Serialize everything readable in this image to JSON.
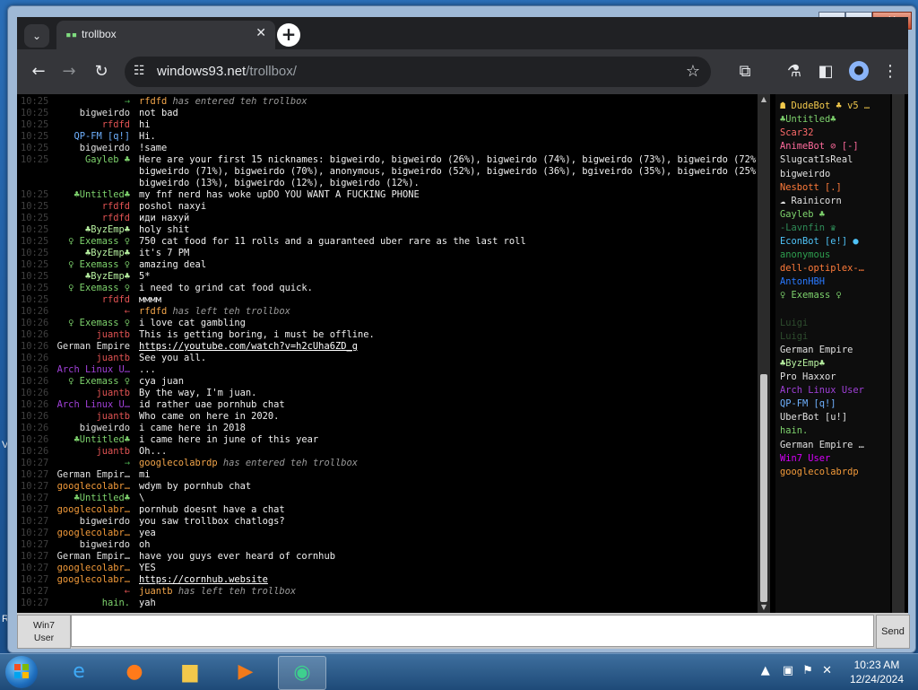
{
  "browser": {
    "tab_title": "trollbox",
    "tab_favicon_text": "▪▪",
    "url_domain": "windows93.net",
    "url_path": "/trollbox/"
  },
  "icons": {
    "tab_menu": "chevron-down-icon",
    "close": "close-icon",
    "newtab": "plus-icon",
    "back": "arrow-left-icon",
    "forward": "arrow-right-icon",
    "reload": "reload-icon",
    "site_info": "tune-icon",
    "bookmark": "star-icon",
    "extensions": "puzzle-icon",
    "labs": "flask-icon",
    "sidepanel": "sidepanel-icon",
    "profile": "profile-icon",
    "menu": "kebab-menu-icon"
  },
  "colors": {
    "timestamp": "#3f3f3f",
    "message": "#f0f0f0",
    "system": "#f2a54a"
  },
  "messages": [
    {
      "time": "10:25",
      "nick": "→",
      "nick_color": "#4caf50",
      "text": "rfdfd",
      "sys": "has entered teh trollbox",
      "type": "system"
    },
    {
      "time": "10:25",
      "nick": "bigweirdo",
      "nick_color": "#e0e0e0",
      "text": "not bad",
      "type": "chat"
    },
    {
      "time": "10:25",
      "nick": "rfdfd",
      "nick_color": "#e25353",
      "text": "hi",
      "type": "chat"
    },
    {
      "time": "10:25",
      "nick": "QP-FM [q!]",
      "nick_color": "#6fb1ff",
      "text": "Hi.",
      "type": "chat"
    },
    {
      "time": "10:25",
      "nick": "bigweirdo",
      "nick_color": "#e0e0e0",
      "text": "!same",
      "type": "chat"
    },
    {
      "time": "10:25",
      "nick": "Gayleb ♣",
      "nick_color": "#7ed36d",
      "text": "Here are your first 15 nicknames: bigweirdo, bigweirdo (26%), bigweirdo (74%), bigweirdo (73%), bigweirdo (72%),",
      "type": "chat"
    },
    {
      "time": "",
      "nick": "",
      "nick_color": "#7ed36d",
      "text": "bigweirdo (71%), bigweirdo (70%), anonymous, bigweirdo (52%), bigweirdo (36%), bgiveirdo (35%), bigweirdo (25%),",
      "type": "chat"
    },
    {
      "time": "",
      "nick": "",
      "nick_color": "#7ed36d",
      "text": "bigweirdo (13%), bigweirdo (12%), bigweirdo (12%).",
      "type": "chat"
    },
    {
      "time": "10:25",
      "nick": "♣Untitled♣",
      "nick_color": "#7ed36d",
      "text": "my fnf nerd has woke upDO YOU WANT A FUCKING PHONE",
      "type": "chat"
    },
    {
      "time": "10:25",
      "nick": "rfdfd",
      "nick_color": "#e25353",
      "text": "poshol naxyi",
      "type": "chat"
    },
    {
      "time": "10:25",
      "nick": "rfdfd",
      "nick_color": "#e25353",
      "text": "иди нахуй",
      "type": "chat"
    },
    {
      "time": "10:25",
      "nick": "♣ByzEmp♣",
      "nick_color": "#b7f0a0",
      "text": "holy shit",
      "type": "chat"
    },
    {
      "time": "10:25",
      "nick": "♀ Exemass ♀",
      "nick_color": "#7ed36d",
      "text": "750 cat food for 11 rolls and a guaranteed uber rare as the last roll",
      "type": "chat"
    },
    {
      "time": "10:25",
      "nick": "♣ByzEmp♣",
      "nick_color": "#b7f0a0",
      "text": "it's 7 PM",
      "type": "chat"
    },
    {
      "time": "10:25",
      "nick": "♀ Exemass ♀",
      "nick_color": "#7ed36d",
      "text": "amazing deal",
      "type": "chat"
    },
    {
      "time": "10:25",
      "nick": "♣ByzEmp♣",
      "nick_color": "#b7f0a0",
      "text": "5*",
      "type": "chat"
    },
    {
      "time": "10:25",
      "nick": "♀ Exemass ♀",
      "nick_color": "#7ed36d",
      "text": "i need to grind cat food quick.",
      "type": "chat"
    },
    {
      "time": "10:25",
      "nick": "rfdfd",
      "nick_color": "#e25353",
      "text": "мммм",
      "type": "chat"
    },
    {
      "time": "10:26",
      "nick": "←",
      "nick_color": "#e25353",
      "text": "rfdfd",
      "sys": "has left teh trollbox",
      "type": "system"
    },
    {
      "time": "10:26",
      "nick": "♀ Exemass ♀",
      "nick_color": "#7ed36d",
      "text": "i love cat gambling",
      "type": "chat"
    },
    {
      "time": "10:26",
      "nick": "juantb",
      "nick_color": "#e25353",
      "text": "This is getting boring, i must be offline.",
      "type": "chat"
    },
    {
      "time": "10:26",
      "nick": "German Empire",
      "nick_color": "#e0e0e0",
      "text": "https://youtube.com/watch?v=h2cUha6ZD_g",
      "type": "link"
    },
    {
      "time": "10:26",
      "nick": "juantb",
      "nick_color": "#e25353",
      "text": "See you all.",
      "type": "chat"
    },
    {
      "time": "10:26",
      "nick": "Arch Linux U…",
      "nick_color": "#a040d8",
      "text": "...",
      "type": "chat"
    },
    {
      "time": "10:26",
      "nick": "♀ Exemass ♀",
      "nick_color": "#7ed36d",
      "text": "cya juan",
      "type": "chat"
    },
    {
      "time": "10:26",
      "nick": "juantb",
      "nick_color": "#e25353",
      "text": "By the way, I'm juan.",
      "type": "chat"
    },
    {
      "time": "10:26",
      "nick": "Arch Linux U…",
      "nick_color": "#a040d8",
      "text": "id rather uae pornhub chat",
      "type": "chat"
    },
    {
      "time": "10:26",
      "nick": "juantb",
      "nick_color": "#e25353",
      "text": "Who came on here in 2020.",
      "type": "chat"
    },
    {
      "time": "10:26",
      "nick": "bigweirdo",
      "nick_color": "#e0e0e0",
      "text": "i came here in 2018",
      "type": "chat"
    },
    {
      "time": "10:26",
      "nick": "♣Untitled♣",
      "nick_color": "#7ed36d",
      "text": "i came here in june of this year",
      "type": "chat"
    },
    {
      "time": "10:26",
      "nick": "juantb",
      "nick_color": "#e25353",
      "text": "Oh...",
      "type": "chat"
    },
    {
      "time": "10:27",
      "nick": "→",
      "nick_color": "#4caf50",
      "text": "googlecolabrdp",
      "sys": "has entered teh trollbox",
      "type": "system"
    },
    {
      "time": "10:27",
      "nick": "German Empir…",
      "nick_color": "#e0e0e0",
      "text": "mi",
      "type": "chat"
    },
    {
      "time": "10:27",
      "nick": "googlecolabr…",
      "nick_color": "#f29a3a",
      "text": "wdym by pornhub chat",
      "type": "chat"
    },
    {
      "time": "10:27",
      "nick": "♣Untitled♣",
      "nick_color": "#7ed36d",
      "text": "\\",
      "type": "chat"
    },
    {
      "time": "10:27",
      "nick": "googlecolabr…",
      "nick_color": "#f29a3a",
      "text": "pornhub doesnt have a chat",
      "type": "chat"
    },
    {
      "time": "10:27",
      "nick": "bigweirdo",
      "nick_color": "#e0e0e0",
      "text": "you saw trollbox chatlogs?",
      "type": "chat"
    },
    {
      "time": "10:27",
      "nick": "googlecolabr…",
      "nick_color": "#f29a3a",
      "text": "yea",
      "type": "chat"
    },
    {
      "time": "10:27",
      "nick": "bigweirdo",
      "nick_color": "#e0e0e0",
      "text": "oh",
      "type": "chat"
    },
    {
      "time": "10:27",
      "nick": "German Empir…",
      "nick_color": "#e0e0e0",
      "text": "have you guys ever heard of cornhub",
      "type": "chat"
    },
    {
      "time": "10:27",
      "nick": "googlecolabr…",
      "nick_color": "#f29a3a",
      "text": "YES",
      "type": "chat"
    },
    {
      "time": "10:27",
      "nick": "googlecolabr…",
      "nick_color": "#f29a3a",
      "text": "https://cornhub.website",
      "type": "link"
    },
    {
      "time": "10:27",
      "nick": "←",
      "nick_color": "#e25353",
      "text": "juantb",
      "sys": "has left teh trollbox",
      "type": "system"
    },
    {
      "time": "10:27",
      "nick": "hain.",
      "nick_color": "#7ed36d",
      "text": "yah",
      "type": "chat"
    }
  ],
  "users": [
    {
      "name": "☗ DudeBot ♣ v5 …",
      "color": "#f2c94c"
    },
    {
      "name": "♣Untitled♣",
      "color": "#7ed36d"
    },
    {
      "name": "Scar32",
      "color": "#ff6b6b"
    },
    {
      "name": "AnimeBot ⊘ [-]",
      "color": "#ff6b9d"
    },
    {
      "name": "SlugcatIsReal",
      "color": "#e0e0e0"
    },
    {
      "name": "bigweirdo",
      "color": "#e0e0e0"
    },
    {
      "name": "Nesbott [.]",
      "color": "#ff7b3a"
    },
    {
      "name": "☁ Rainicorn",
      "color": "#e0e0e0"
    },
    {
      "name": "Gayleb ♣",
      "color": "#7ed36d"
    },
    {
      "name": "-Lavnfin ♛",
      "color": "#2e8b57"
    },
    {
      "name": "EconBot [e!] ●",
      "color": "#4fc3f7"
    },
    {
      "name": "anonymous",
      "color": "#2e9e4f"
    },
    {
      "name": "dell-optiplex-…",
      "color": "#ff7b3a"
    },
    {
      "name": "AntonHBH",
      "color": "#2979ff"
    },
    {
      "name": "♀ Exemass ♀",
      "color": "#7ed36d"
    },
    {
      "name": "",
      ":color": "#4a148c",
      "color": "#4a148c"
    },
    {
      "name": "Luigi",
      "color": "#2e4d2e"
    },
    {
      "name": "Luigi",
      "color": "#2e4d2e"
    },
    {
      "name": "German Empire",
      "color": "#e0e0e0"
    },
    {
      "name": "♣ByzEmp♣",
      "color": "#b7f0a0"
    },
    {
      "name": "Pro Haxxor",
      "color": "#e0e0e0"
    },
    {
      "name": "Arch Linux User",
      "color": "#a040d8"
    },
    {
      "name": "QP-FM [q!]",
      "color": "#6fb1ff"
    },
    {
      "name": "UberBot [u!]",
      "color": "#e0e0e0"
    },
    {
      "name": "hain.",
      "color": "#7ed36d"
    },
    {
      "name": "German Empire …",
      "color": "#e0e0e0"
    },
    {
      "name": "Win7 User",
      "color": "#d500f9"
    },
    {
      "name": "googlecolabrdp",
      "color": "#f29a3a"
    }
  ],
  "input": {
    "user_line1": "Win7",
    "user_line2": "User",
    "send_label": "Send"
  },
  "taskbar": {
    "apps": [
      {
        "name": "internet-explorer-icon",
        "glyph": "e",
        "color": "#3fa9f5"
      },
      {
        "name": "firefox-icon",
        "glyph": "●",
        "color": "#ff7a1a"
      },
      {
        "name": "file-explorer-icon",
        "glyph": "▆",
        "color": "#f2c84b"
      },
      {
        "name": "media-player-icon",
        "glyph": "▶",
        "color": "#f27a1a"
      },
      {
        "name": "chrome-app-icon",
        "glyph": "◉",
        "color": "#3ecf8e",
        "active": true
      }
    ],
    "time": "10:23 AM",
    "date": "12/24/2024"
  }
}
